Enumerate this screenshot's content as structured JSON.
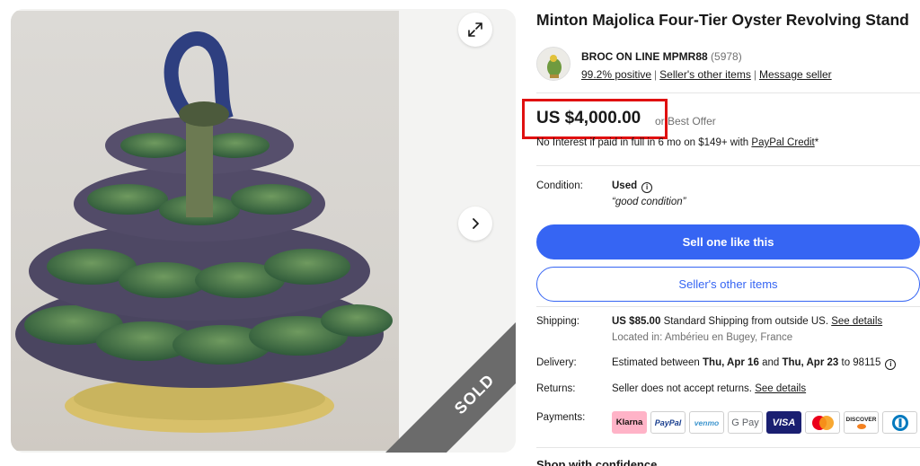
{
  "listing": {
    "title": "Minton Majolica Four-Tier Oyster Revolving Stand",
    "sold_badge": "SOLD"
  },
  "seller": {
    "name": "BROC ON LINE MPMR88",
    "feedback_count": "(5978)",
    "positive": "99.2% positive",
    "other_items": "Seller's other items",
    "message": "Message seller"
  },
  "price": {
    "amount": "US $4,000.00",
    "best_offer": "or Best Offer",
    "credit_prefix": "No Interest if paid in full in 6 mo on $149+ with",
    "credit_link": "PayPal Credit",
    "credit_suffix": "*"
  },
  "condition": {
    "label": "Condition:",
    "value": "Used",
    "note": "“good condition”"
  },
  "buttons": {
    "sell_one": "Sell one like this",
    "other_items": "Seller's other items"
  },
  "shipping": {
    "label": "Shipping:",
    "cost": "US $85.00",
    "method": "Standard Shipping from outside US.",
    "details_link": "See details",
    "location": "Located in: Ambérieu en Bugey, France"
  },
  "delivery": {
    "label": "Delivery:",
    "prefix": "Estimated between",
    "start": "Thu, Apr 16",
    "and": "and",
    "end": "Thu, Apr 23",
    "to": "to 98115"
  },
  "returns": {
    "label": "Returns:",
    "text": "Seller does not accept returns.",
    "details_link": "See details"
  },
  "payments": {
    "label": "Payments:",
    "methods": [
      "Klarna",
      "PayPal",
      "venmo",
      "G Pay",
      "VISA",
      "",
      "DISCOVER",
      ""
    ]
  },
  "footer": {
    "shop_confidence": "Shop with confidence"
  },
  "colors": {
    "accent": "#3665f3",
    "highlight_box": "#e01010"
  }
}
